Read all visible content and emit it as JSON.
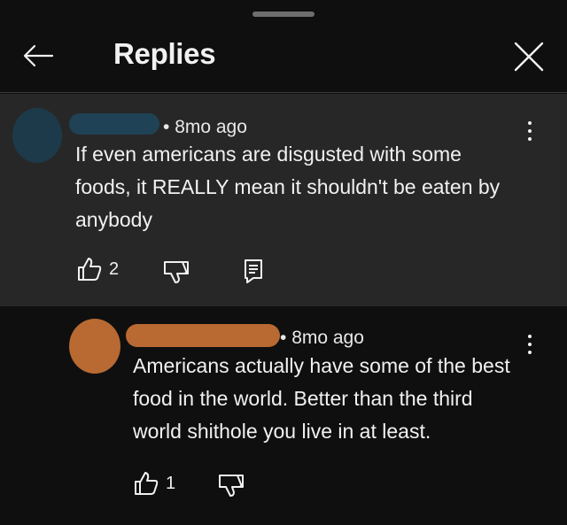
{
  "header": {
    "title": "Replies",
    "back_icon": "arrow-left-icon",
    "close_icon": "close-icon"
  },
  "parent_comment": {
    "time": "8mo ago",
    "text": "If even americans are disgusted with some foods, it REALLY mean it shouldn't be eaten by anybody",
    "likes": "2",
    "avatar_color": "#1d3a4a",
    "name_color": "#1f4256"
  },
  "reply_comment": {
    "time": "8mo ago",
    "text": "Americans actually have some of the best food in the world. Better than the third world shithole you live in at least.",
    "likes": "1",
    "avatar_color": "#b86a32",
    "name_color": "#b86a32"
  },
  "colors": {
    "background": "#0f0f0f",
    "thread_bg": "#272727",
    "text": "#f1f1f1"
  }
}
